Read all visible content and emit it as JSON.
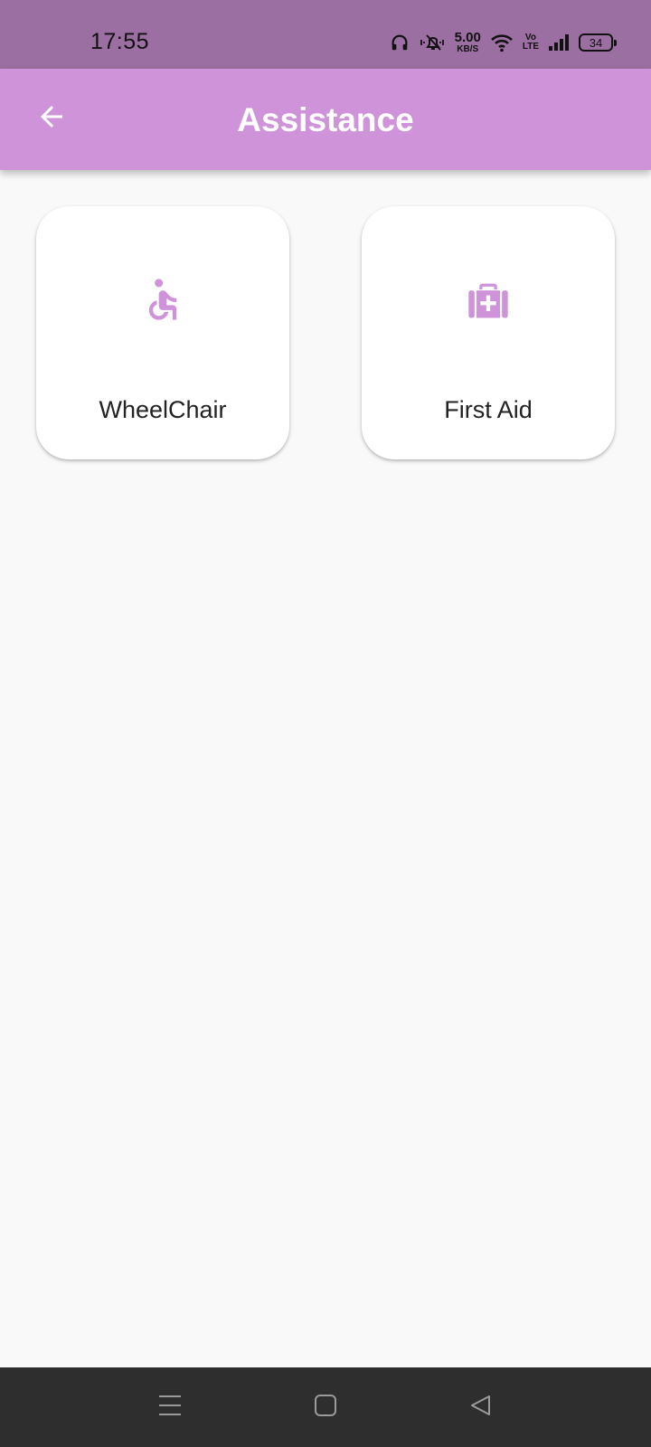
{
  "status_bar": {
    "time": "17:55",
    "net_speed_value": "5.00",
    "net_speed_unit": "KB/S",
    "volte_top": "Vo",
    "volte_bottom": "LTE",
    "battery": "34",
    "icons": [
      "headphones-icon",
      "bell-muted-icon",
      "wifi-icon",
      "volte-icon",
      "signal-icon",
      "battery-icon"
    ]
  },
  "app_bar": {
    "title": "Assistance",
    "back_icon": "arrow-back-icon",
    "background": "#ce93d8"
  },
  "cards": [
    {
      "label": "WheelChair",
      "icon": "wheelchair-icon"
    },
    {
      "label": "First Aid",
      "icon": "medical-bag-icon"
    }
  ],
  "colors": {
    "accent": "#ce93d8",
    "status_bar": "#9b6fa1",
    "background": "#f9f9f9",
    "nav_bar": "#2e2e2e"
  },
  "nav_bar": {
    "icons": [
      "menu-icon",
      "home-icon",
      "back-triangle-icon"
    ]
  }
}
